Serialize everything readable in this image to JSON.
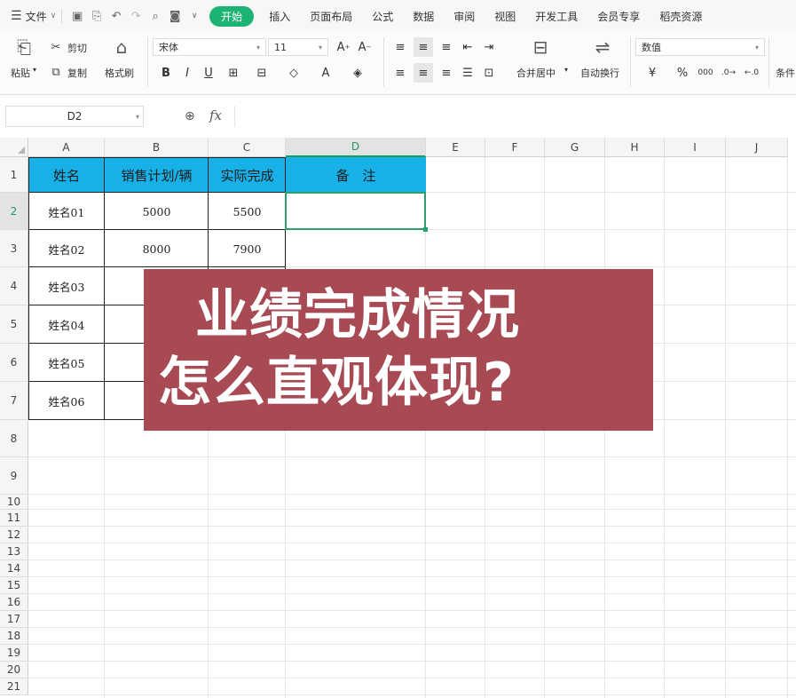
{
  "menubar": {
    "file_label": "文件",
    "tabs": [
      "开始",
      "插入",
      "页面布局",
      "公式",
      "数据",
      "审阅",
      "视图",
      "开发工具",
      "会员专享",
      "稻壳资源"
    ],
    "active_tab": "开始"
  },
  "ribbon": {
    "paste_label": "粘贴",
    "cut_label": "剪切",
    "copy_label": "复制",
    "format_painter_label": "格式刷",
    "font_name": "宋体",
    "font_size": "11",
    "merge_label": "合并居中",
    "wrap_label": "自动换行",
    "number_format": "数值",
    "currency_symbol": "¥",
    "percent_symbol": "%",
    "thousands_label": "000",
    "cond_label": "条件"
  },
  "formula_bar": {
    "cell_ref": "D2",
    "formula": ""
  },
  "grid": {
    "columns": [
      "A",
      "B",
      "C",
      "D",
      "E",
      "F",
      "G",
      "H",
      "I",
      "J"
    ],
    "rows": [
      "1",
      "2",
      "3",
      "4",
      "5",
      "6",
      "7",
      "8",
      "9",
      "10",
      "11",
      "12",
      "13",
      "14",
      "15",
      "16",
      "17",
      "18",
      "19",
      "20",
      "21"
    ],
    "active_column": "D",
    "active_row": "2"
  },
  "table": {
    "headers": [
      "姓名",
      "销售计划/辆",
      "实际完成",
      "备　注"
    ],
    "rows": [
      [
        "姓名01",
        "5000",
        "5500",
        ""
      ],
      [
        "姓名02",
        "8000",
        "7900",
        ""
      ],
      [
        "姓名03",
        "",
        "",
        ""
      ],
      [
        "姓名04",
        "",
        "",
        ""
      ],
      [
        "姓名05",
        "",
        "",
        ""
      ],
      [
        "姓名06",
        "",
        "",
        ""
      ]
    ]
  },
  "banner": {
    "line1": "业绩完成情况",
    "line2": "怎么直观体现?"
  }
}
